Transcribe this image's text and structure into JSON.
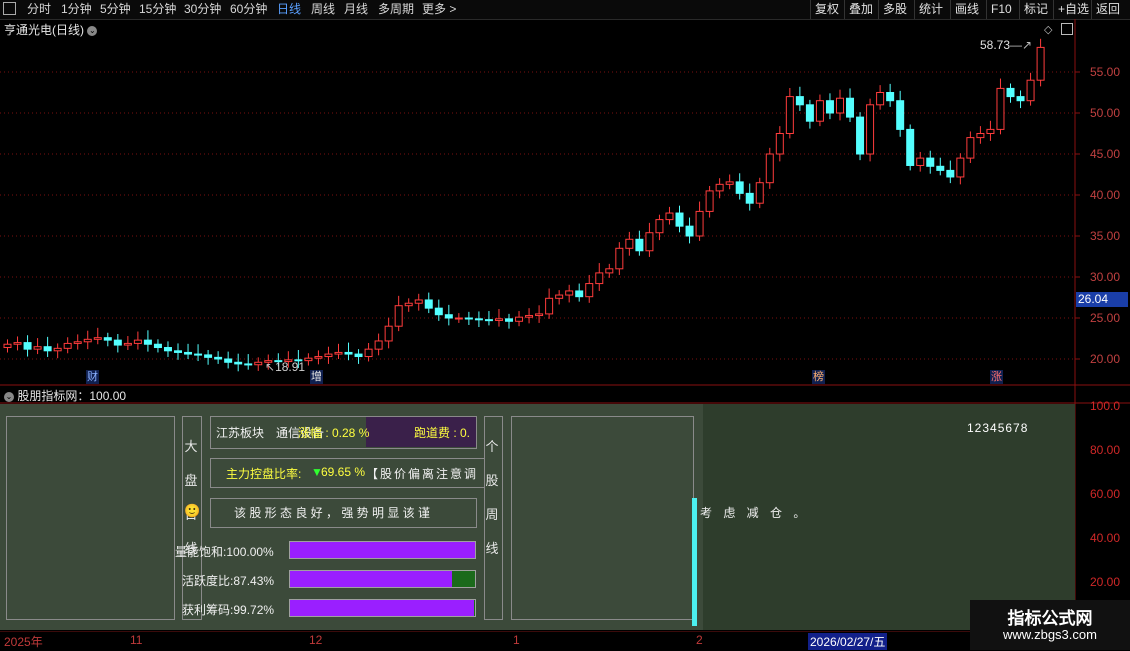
{
  "toolbar": {
    "periods": [
      "分时",
      "1分钟",
      "5分钟",
      "15分钟",
      "30分钟",
      "60分钟",
      "日线",
      "周线",
      "月线",
      "多周期",
      "更多 >"
    ],
    "selected": "日线",
    "right": [
      "复权",
      "叠加",
      "多股",
      "统计",
      "画线",
      "F10",
      "标记",
      "+自选",
      "返回"
    ]
  },
  "price_panel": {
    "title": "亨通光电(日线)",
    "high_label": "58.73",
    "low_label": "18.91",
    "current_price": "26.04",
    "y_ticks": [
      "55.00",
      "50.00",
      "45.00",
      "40.00",
      "35.00",
      "30.00",
      "25.00",
      "20.00"
    ],
    "markers": [
      "财",
      "增",
      "榜",
      "涨"
    ]
  },
  "indicator_panel": {
    "title": "股朋指标网：100.00",
    "y_ticks": [
      "100.0",
      "80.00",
      "60.00",
      "40.00",
      "20.00"
    ],
    "left_vertical": "大 盘 日 线",
    "mid_vertical": "个 股 周 线",
    "sector": "江苏板块",
    "sector_sub": "通信设备",
    "change": "涨幅 : 0.28 %",
    "runway_label": "跑道费 : 0.",
    "control_label": "主力控盘比率:",
    "control_value": "69.65 %",
    "deviation": "【股价偏离注意调",
    "commentary": "该 股 形 态 良 好 ， 强 势 明 显 该 谨",
    "commentary2": "考 虑 减 仓 。",
    "face_icon": "smiley-face-icon",
    "metrics": [
      {
        "label": "量能饱和:",
        "value": "100.00%",
        "fill": 1.0
      },
      {
        "label": "活跃度比:",
        "value": "87.43%",
        "fill": 0.8743
      },
      {
        "label": "获利筹码:",
        "value": "99.72%",
        "fill": 0.9972
      }
    ],
    "digits": "12345678"
  },
  "date_axis": [
    "2025年",
    "11",
    "12",
    "1",
    "2",
    "2026/02/27/五"
  ],
  "watermark": {
    "line1": "指标公式网",
    "line2": "www.zbgs3.com"
  },
  "colors": {
    "up": "#ff3c3c",
    "down": "#54ffff",
    "orange": "#ff6a12",
    "cyan": "#4cf0f0",
    "purple": "#9a1fff"
  }
}
